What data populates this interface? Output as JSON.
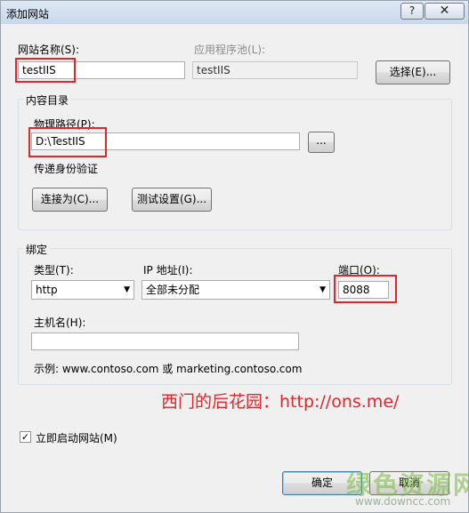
{
  "window": {
    "title": "添加网站",
    "help_glyph": "?",
    "close_glyph": "✕"
  },
  "site": {
    "name_label": "网站名称(S):",
    "name_value": "testIIS",
    "pool_label": "应用程序池(L):",
    "pool_value": "testIIS",
    "select_button": "选择(E)..."
  },
  "content": {
    "group_label": "内容目录",
    "path_label": "物理路径(P):",
    "path_value": "D:\\TestIIS",
    "browse_button": "...",
    "passthrough_label": "传递身份验证",
    "connect_button": "连接为(C)...",
    "test_button": "测试设置(G)..."
  },
  "binding": {
    "group_label": "绑定",
    "type_label": "类型(T):",
    "type_value": "http",
    "ip_label": "IP 地址(I):",
    "ip_value": "全部未分配",
    "port_label": "端口(O):",
    "port_value": "8088",
    "host_label": "主机名(H):",
    "host_value": "",
    "example_text": "示例: www.contoso.com 或 marketing.contoso.com"
  },
  "overlay": {
    "caption": "西门的后花园：http://ons.me/"
  },
  "start": {
    "checked": true,
    "label": "立即启动网站(M)"
  },
  "footer": {
    "ok_button": "确定",
    "cancel_button": "取消"
  },
  "watermark": {
    "brand": "绿色资源网",
    "url": "www.downcc.com"
  },
  "colors": {
    "highlight": "#e0262c"
  }
}
